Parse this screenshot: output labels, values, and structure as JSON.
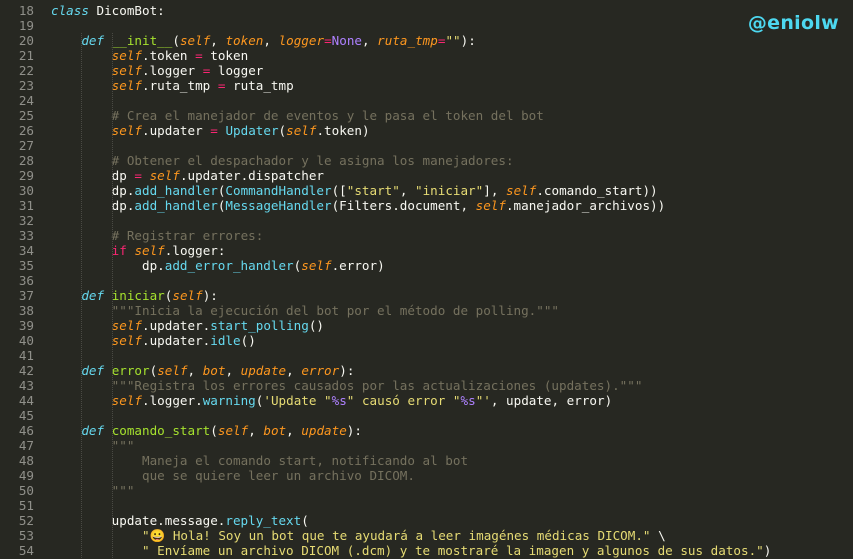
{
  "watermark": "@eniolw",
  "lines": [
    {
      "n": "18",
      "t": [
        [
          "kw",
          "class"
        ],
        [
          "plain",
          " DicomBot:"
        ]
      ]
    },
    {
      "n": "19",
      "t": []
    },
    {
      "n": "20",
      "t": [
        [
          "plain",
          "    "
        ],
        [
          "kw",
          "def"
        ],
        [
          "plain",
          " "
        ],
        [
          "fn",
          "__init__"
        ],
        [
          "plain",
          "("
        ],
        [
          "par",
          "self"
        ],
        [
          "plain",
          ", "
        ],
        [
          "par",
          "token"
        ],
        [
          "plain",
          ", "
        ],
        [
          "par",
          "logger"
        ],
        [
          "op",
          "="
        ],
        [
          "const",
          "None"
        ],
        [
          "plain",
          ", "
        ],
        [
          "par",
          "ruta_tmp"
        ],
        [
          "op",
          "="
        ],
        [
          "str",
          "\"\""
        ],
        [
          "plain",
          "):"
        ]
      ]
    },
    {
      "n": "21",
      "t": [
        [
          "plain",
          "        "
        ],
        [
          "self",
          "self"
        ],
        [
          "plain",
          ".token "
        ],
        [
          "op",
          "="
        ],
        [
          "plain",
          " token"
        ]
      ]
    },
    {
      "n": "22",
      "t": [
        [
          "plain",
          "        "
        ],
        [
          "self",
          "self"
        ],
        [
          "plain",
          ".logger "
        ],
        [
          "op",
          "="
        ],
        [
          "plain",
          " logger"
        ]
      ]
    },
    {
      "n": "23",
      "t": [
        [
          "plain",
          "        "
        ],
        [
          "self",
          "self"
        ],
        [
          "plain",
          ".ruta_tmp "
        ],
        [
          "op",
          "="
        ],
        [
          "plain",
          " ruta_tmp"
        ]
      ]
    },
    {
      "n": "24",
      "t": []
    },
    {
      "n": "25",
      "t": [
        [
          "plain",
          "        "
        ],
        [
          "com",
          "# Crea el manejador de eventos y le pasa el token del bot"
        ]
      ]
    },
    {
      "n": "26",
      "t": [
        [
          "plain",
          "        "
        ],
        [
          "self",
          "self"
        ],
        [
          "plain",
          ".updater "
        ],
        [
          "op",
          "="
        ],
        [
          "plain",
          " "
        ],
        [
          "bi",
          "Updater"
        ],
        [
          "plain",
          "("
        ],
        [
          "self",
          "self"
        ],
        [
          "plain",
          ".token)"
        ]
      ]
    },
    {
      "n": "27",
      "t": []
    },
    {
      "n": "28",
      "t": [
        [
          "plain",
          "        "
        ],
        [
          "com",
          "# Obtener el despachador y le asigna los manejadores:"
        ]
      ]
    },
    {
      "n": "29",
      "t": [
        [
          "plain",
          "        dp "
        ],
        [
          "op",
          "="
        ],
        [
          "plain",
          " "
        ],
        [
          "self",
          "self"
        ],
        [
          "plain",
          ".updater.dispatcher"
        ]
      ]
    },
    {
      "n": "30",
      "t": [
        [
          "plain",
          "        dp."
        ],
        [
          "bi",
          "add_handler"
        ],
        [
          "plain",
          "("
        ],
        [
          "bi",
          "CommandHandler"
        ],
        [
          "plain",
          "(["
        ],
        [
          "str",
          "\"start\""
        ],
        [
          "plain",
          ", "
        ],
        [
          "str",
          "\"iniciar\""
        ],
        [
          "plain",
          "], "
        ],
        [
          "self",
          "self"
        ],
        [
          "plain",
          ".comando_start))"
        ]
      ]
    },
    {
      "n": "31",
      "t": [
        [
          "plain",
          "        dp."
        ],
        [
          "bi",
          "add_handler"
        ],
        [
          "plain",
          "("
        ],
        [
          "bi",
          "MessageHandler"
        ],
        [
          "plain",
          "(Filters.document, "
        ],
        [
          "self",
          "self"
        ],
        [
          "plain",
          ".manejador_archivos))"
        ]
      ]
    },
    {
      "n": "32",
      "t": []
    },
    {
      "n": "33",
      "t": [
        [
          "plain",
          "        "
        ],
        [
          "com",
          "# Registrar errores:"
        ]
      ]
    },
    {
      "n": "34",
      "t": [
        [
          "plain",
          "        "
        ],
        [
          "kwr",
          "if"
        ],
        [
          "plain",
          " "
        ],
        [
          "self",
          "self"
        ],
        [
          "plain",
          ".logger:"
        ]
      ]
    },
    {
      "n": "35",
      "t": [
        [
          "plain",
          "            dp."
        ],
        [
          "bi",
          "add_error_handler"
        ],
        [
          "plain",
          "("
        ],
        [
          "self",
          "self"
        ],
        [
          "plain",
          ".error)"
        ]
      ]
    },
    {
      "n": "36",
      "t": []
    },
    {
      "n": "37",
      "t": [
        [
          "plain",
          "    "
        ],
        [
          "kw",
          "def"
        ],
        [
          "plain",
          " "
        ],
        [
          "fn",
          "iniciar"
        ],
        [
          "plain",
          "("
        ],
        [
          "par",
          "self"
        ],
        [
          "plain",
          "):"
        ]
      ]
    },
    {
      "n": "38",
      "t": [
        [
          "plain",
          "        "
        ],
        [
          "com",
          "\"\"\"Inicia la ejecución del bot por el método de polling.\"\"\""
        ]
      ]
    },
    {
      "n": "39",
      "t": [
        [
          "plain",
          "        "
        ],
        [
          "self",
          "self"
        ],
        [
          "plain",
          ".updater."
        ],
        [
          "bi",
          "start_polling"
        ],
        [
          "plain",
          "()"
        ]
      ]
    },
    {
      "n": "40",
      "t": [
        [
          "plain",
          "        "
        ],
        [
          "self",
          "self"
        ],
        [
          "plain",
          ".updater."
        ],
        [
          "bi",
          "idle"
        ],
        [
          "plain",
          "()"
        ]
      ]
    },
    {
      "n": "41",
      "t": []
    },
    {
      "n": "42",
      "t": [
        [
          "plain",
          "    "
        ],
        [
          "kw",
          "def"
        ],
        [
          "plain",
          " "
        ],
        [
          "fn",
          "error"
        ],
        [
          "plain",
          "("
        ],
        [
          "par",
          "self"
        ],
        [
          "plain",
          ", "
        ],
        [
          "par",
          "bot"
        ],
        [
          "plain",
          ", "
        ],
        [
          "par",
          "update"
        ],
        [
          "plain",
          ", "
        ],
        [
          "par",
          "error"
        ],
        [
          "plain",
          "):"
        ]
      ]
    },
    {
      "n": "43",
      "t": [
        [
          "plain",
          "        "
        ],
        [
          "com",
          "\"\"\"Registra los errores causados por las actualizaciones (updates).\"\"\""
        ]
      ]
    },
    {
      "n": "44",
      "t": [
        [
          "plain",
          "        "
        ],
        [
          "self",
          "self"
        ],
        [
          "plain",
          ".logger."
        ],
        [
          "bi",
          "warning"
        ],
        [
          "plain",
          "("
        ],
        [
          "str",
          "'Update \""
        ],
        [
          "const",
          "%s"
        ],
        [
          "str",
          "\" causó error \""
        ],
        [
          "const",
          "%s"
        ],
        [
          "str",
          "\"'"
        ],
        [
          "plain",
          ", update, error)"
        ]
      ]
    },
    {
      "n": "45",
      "t": []
    },
    {
      "n": "46",
      "t": [
        [
          "plain",
          "    "
        ],
        [
          "kw",
          "def"
        ],
        [
          "plain",
          " "
        ],
        [
          "fn",
          "comando_start"
        ],
        [
          "plain",
          "("
        ],
        [
          "par",
          "self"
        ],
        [
          "plain",
          ", "
        ],
        [
          "par",
          "bot"
        ],
        [
          "plain",
          ", "
        ],
        [
          "par",
          "update"
        ],
        [
          "plain",
          "):"
        ]
      ]
    },
    {
      "n": "47",
      "t": [
        [
          "plain",
          "        "
        ],
        [
          "com",
          "\"\"\""
        ]
      ]
    },
    {
      "n": "48",
      "t": [
        [
          "plain",
          "            "
        ],
        [
          "com",
          "Maneja el comando start, notificando al bot"
        ]
      ]
    },
    {
      "n": "49",
      "t": [
        [
          "plain",
          "            "
        ],
        [
          "com",
          "que se quiere leer un archivo DICOM."
        ]
      ]
    },
    {
      "n": "50",
      "t": [
        [
          "plain",
          "        "
        ],
        [
          "com",
          "\"\"\""
        ]
      ]
    },
    {
      "n": "51",
      "t": []
    },
    {
      "n": "52",
      "t": [
        [
          "plain",
          "        update.message."
        ],
        [
          "bi",
          "reply_text"
        ],
        [
          "plain",
          "("
        ]
      ]
    },
    {
      "n": "53",
      "t": [
        [
          "plain",
          "            "
        ],
        [
          "str",
          "\"😀 Hola! Soy un bot que te ayudará a leer imagénes médicas DICOM.\""
        ],
        [
          "plain",
          " \\"
        ]
      ]
    },
    {
      "n": "54",
      "t": [
        [
          "plain",
          "            "
        ],
        [
          "str",
          "\" Envíame un archivo DICOM (.dcm) y te mostraré la imagen y algunos de sus datos.\""
        ],
        [
          "plain",
          ")"
        ]
      ]
    }
  ]
}
